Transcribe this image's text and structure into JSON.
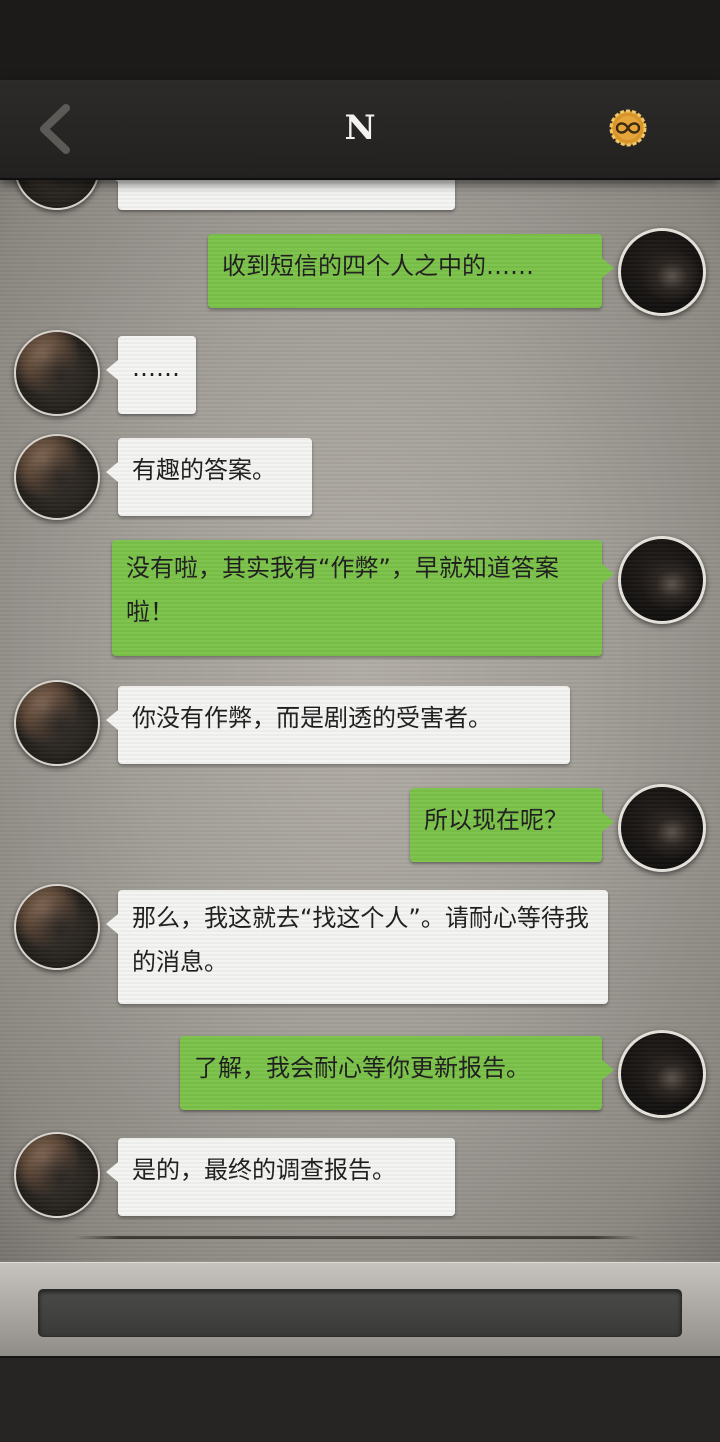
{
  "header": {
    "title": "N",
    "back_icon": "chevron-left-icon",
    "badge_icon": "infinity-badge-icon",
    "badge_color": "#e0a030"
  },
  "messages": [
    {
      "from": "partner",
      "text": ""
    },
    {
      "from": "me",
      "text": "收到短信的四个人之中的……"
    },
    {
      "from": "partner",
      "text": "……"
    },
    {
      "from": "partner",
      "text": "有趣的答案。"
    },
    {
      "from": "me",
      "text": "没有啦，其实我有“作弊”，早就知道答案啦！"
    },
    {
      "from": "partner",
      "text": "你没有作弊，而是剧透的受害者。"
    },
    {
      "from": "me",
      "text": "所以现在呢？"
    },
    {
      "from": "partner",
      "text": "那么，我这就去“找这个人”。请耐心等待我的消息。"
    },
    {
      "from": "me",
      "text": "了解，我会耐心等你更新报告。"
    },
    {
      "from": "partner",
      "text": "是的，最终的调查报告。"
    }
  ],
  "colors": {
    "outgoing_bubble": "#7cc24a",
    "incoming_bubble": "#f4f4f2"
  },
  "input": {
    "value": "",
    "placeholder": ""
  }
}
